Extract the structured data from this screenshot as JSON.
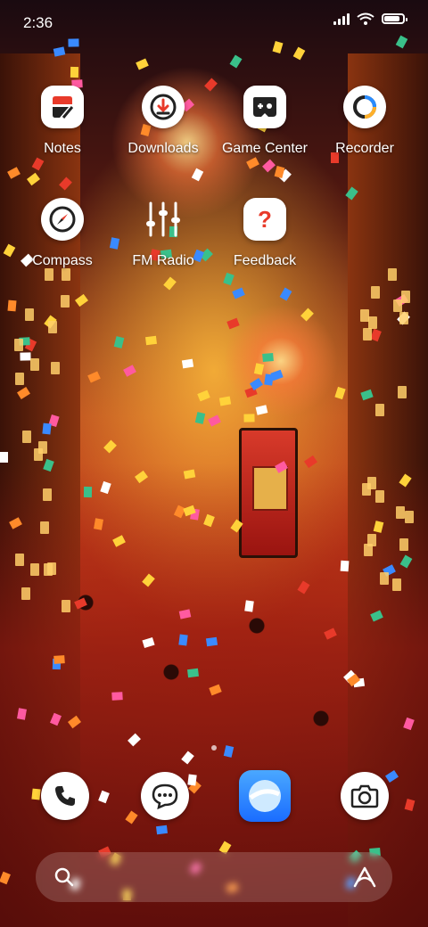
{
  "status_bar": {
    "time": "2:36",
    "battery_fraction": 0.85
  },
  "apps": [
    {
      "label": "Notes",
      "icon": "notes-icon"
    },
    {
      "label": "Downloads",
      "icon": "download-icon"
    },
    {
      "label": "Game Center",
      "icon": "gamepad-icon"
    },
    {
      "label": "Recorder",
      "icon": "recorder-icon"
    },
    {
      "label": "Compass",
      "icon": "compass-icon"
    },
    {
      "label": "FM Radio",
      "icon": "equalizer-icon"
    },
    {
      "label": "Feedback",
      "icon": "question-icon",
      "glyph": "?"
    }
  ],
  "dock": [
    {
      "icon": "phone-icon"
    },
    {
      "icon": "message-icon"
    },
    {
      "icon": "browser-icon"
    },
    {
      "icon": "camera-icon"
    }
  ],
  "search_bar": {
    "left_icon": "search-icon",
    "right_icon": "assistant-icon"
  },
  "colors": {
    "accent_red": "#e83a2a",
    "accent_gold": "#ffcf6a",
    "browser_blue": "#1a6cff"
  }
}
